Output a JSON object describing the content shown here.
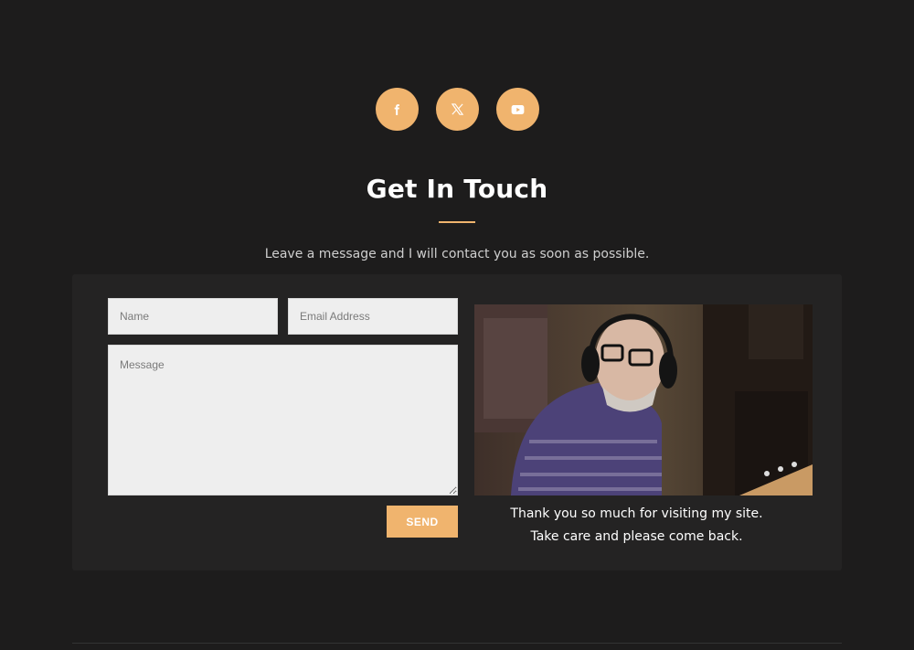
{
  "social": {
    "items": [
      {
        "icon": "facebook-icon",
        "label": "f"
      },
      {
        "icon": "x-twitter-icon",
        "label": "X"
      },
      {
        "icon": "youtube-icon",
        "label": "YouTube"
      }
    ]
  },
  "contact": {
    "title": "Get In Touch",
    "subtitle": "Leave a message and I will contact you as soon as possible.",
    "form": {
      "name_placeholder": "Name",
      "name_value": "",
      "email_placeholder": "Email Address",
      "email_value": "",
      "message_placeholder": "Message",
      "message_value": "",
      "send_label": "SEND"
    },
    "thanks_line1": "Thank you so much for visiting my site.",
    "thanks_line2": "Take care and please come back."
  },
  "colors": {
    "background": "#1d1c1c",
    "panel": "#242323",
    "accent": "#f0b46e",
    "field": "#eeeeee"
  }
}
